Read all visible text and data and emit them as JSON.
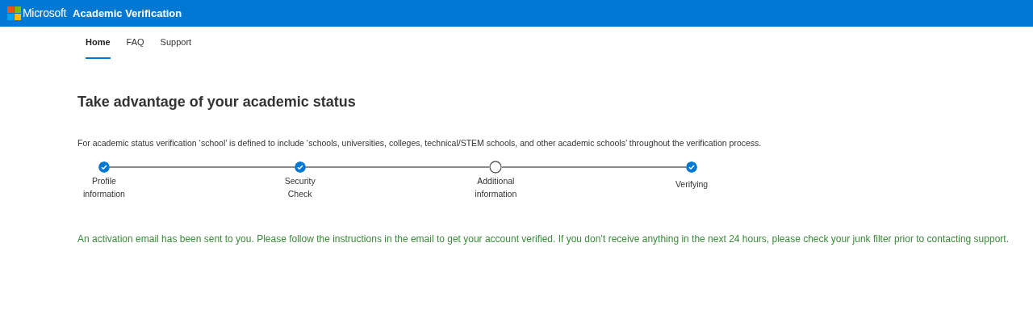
{
  "header": {
    "brand": "Microsoft",
    "title": "Academic Verification"
  },
  "tabs": [
    {
      "label": "Home",
      "selected": true
    },
    {
      "label": "FAQ",
      "selected": false
    },
    {
      "label": "Support",
      "selected": false
    }
  ],
  "heading": "Take advantage of your academic status",
  "description": "For academic status verification ‘school’ is defined to include ‘schools, universities, colleges, technical/STEM schools, and other academic schools’ throughout the verification process.",
  "steps": [
    {
      "label": "Profile information",
      "done": true
    },
    {
      "label": "Security Check",
      "done": true
    },
    {
      "label": "Additional information",
      "done": false
    },
    {
      "label": "Verifying",
      "done": true
    }
  ],
  "message": "An activation email has been sent to you. Please follow the instructions in the email to get your account verified. If you don’t receive anything in the next 24 hours, please check your junk filter prior to contacting support."
}
